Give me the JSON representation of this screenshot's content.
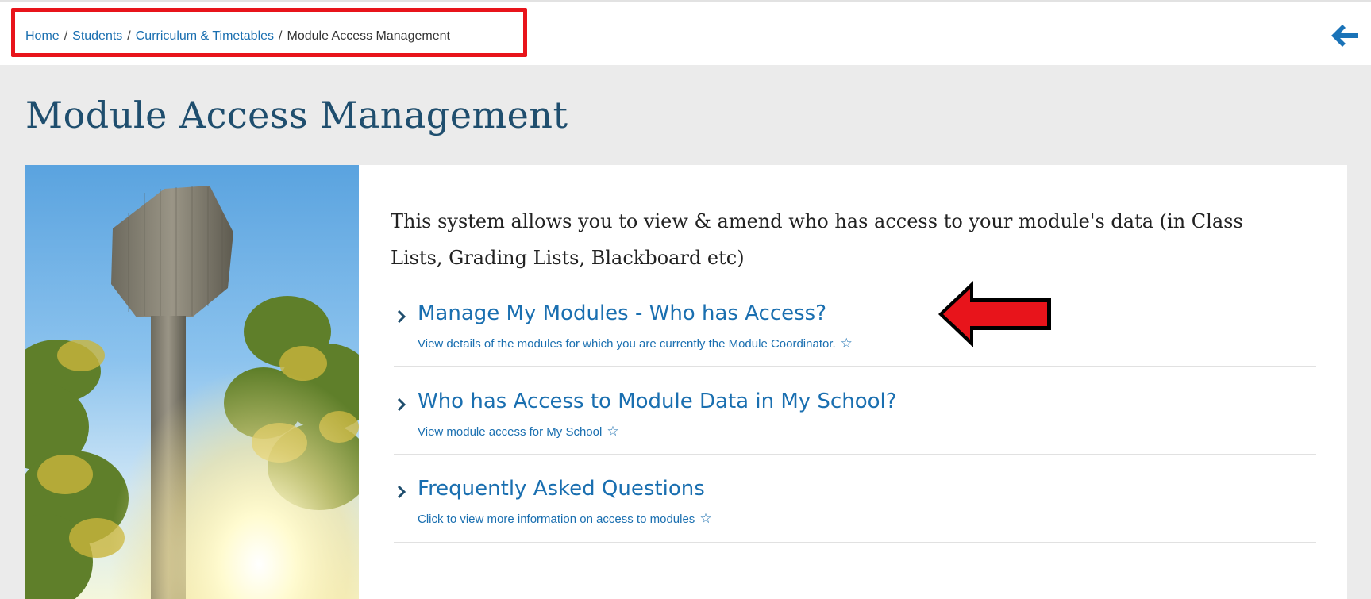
{
  "breadcrumb": {
    "items": [
      {
        "label": "Home"
      },
      {
        "label": "Students"
      },
      {
        "label": "Curriculum & Timetables"
      }
    ],
    "separator": "/",
    "current": "Module Access Management"
  },
  "page": {
    "title": "Module Access Management"
  },
  "intro": {
    "text": "This system allows you to view & amend who has access to your module's data (in Class Lists, Grading Lists, Blackboard etc)"
  },
  "links": [
    {
      "title": "Manage My Modules - Who has Access?",
      "description": "View details of the modules for which you are currently the Module Coordinator."
    },
    {
      "title": "Who has Access to Module Data in My School?",
      "description": "View module access for My School"
    },
    {
      "title": "Frequently Asked Questions",
      "description": "Click to view more information on access to modules"
    }
  ],
  "icons": {
    "back": "arrow-left-icon",
    "chevron": "chevron-right-icon",
    "favorite": "star-outline-icon",
    "annotation": "red-arrow-annotation"
  },
  "colors": {
    "link": "#1a6fb0",
    "title": "#1f4e6e",
    "annotation": "#e8141b",
    "page_bg": "#ebebeb"
  }
}
